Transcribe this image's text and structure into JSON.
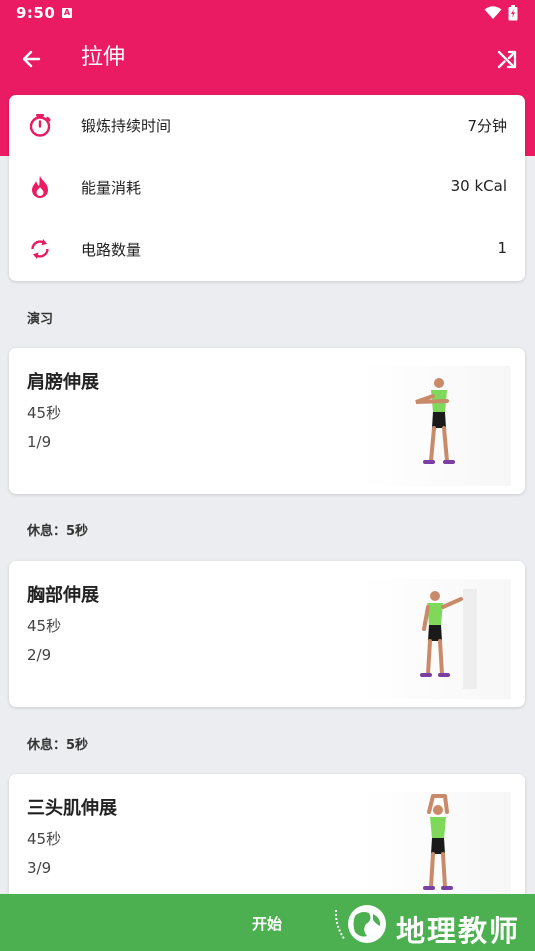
{
  "status_bar": {
    "time": "9:50"
  },
  "header": {
    "title": "拉伸",
    "back_icon": "arrow-left-icon",
    "shuffle_icon": "shuffle-icon"
  },
  "stats": [
    {
      "icon": "stopwatch-icon",
      "label": "锻炼持续时间",
      "value": "7分钟"
    },
    {
      "icon": "flame-icon",
      "label": "能量消耗",
      "value": "30 kCal"
    },
    {
      "icon": "refresh-icon",
      "label": "电路数量",
      "value": "1"
    }
  ],
  "section_title": "演习",
  "exercises": [
    {
      "name": "肩膀伸展",
      "duration": "45秒",
      "count": "1/9"
    },
    {
      "name": "胸部伸展",
      "duration": "45秒",
      "count": "2/9"
    },
    {
      "name": "三头肌伸展",
      "duration": "45秒",
      "count": "3/9"
    }
  ],
  "rest_label": "休息：5秒",
  "bottom": {
    "start_label": "开始",
    "watermark": "地理教师"
  },
  "colors": {
    "primary": "#ea1b62",
    "accent_green": "#4caf50",
    "background": "#ebedf0"
  }
}
